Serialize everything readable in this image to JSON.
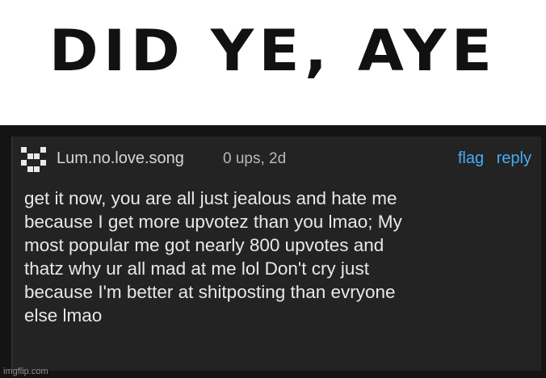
{
  "header": {
    "title": "Did ye, aye"
  },
  "comment": {
    "username": "Lum.no.love.song",
    "meta": "0 ups, 2d",
    "actions": {
      "flag": "flag",
      "reply": "reply"
    },
    "text": "get it now, you are all just jealous and hate me\nbecause I get more upvotez than you lmao; My\nmost popular me got nearly 800 upvotes and\nthatz why ur all mad at me lol Don't cry just\nbecause I'm better at shitposting than evryone\nelse lmao"
  },
  "footer": {
    "watermark": "imgflip.com"
  },
  "colors": {
    "accent": "#45aef7",
    "panel_bg": "#232323",
    "text": "#e8e8e8"
  }
}
